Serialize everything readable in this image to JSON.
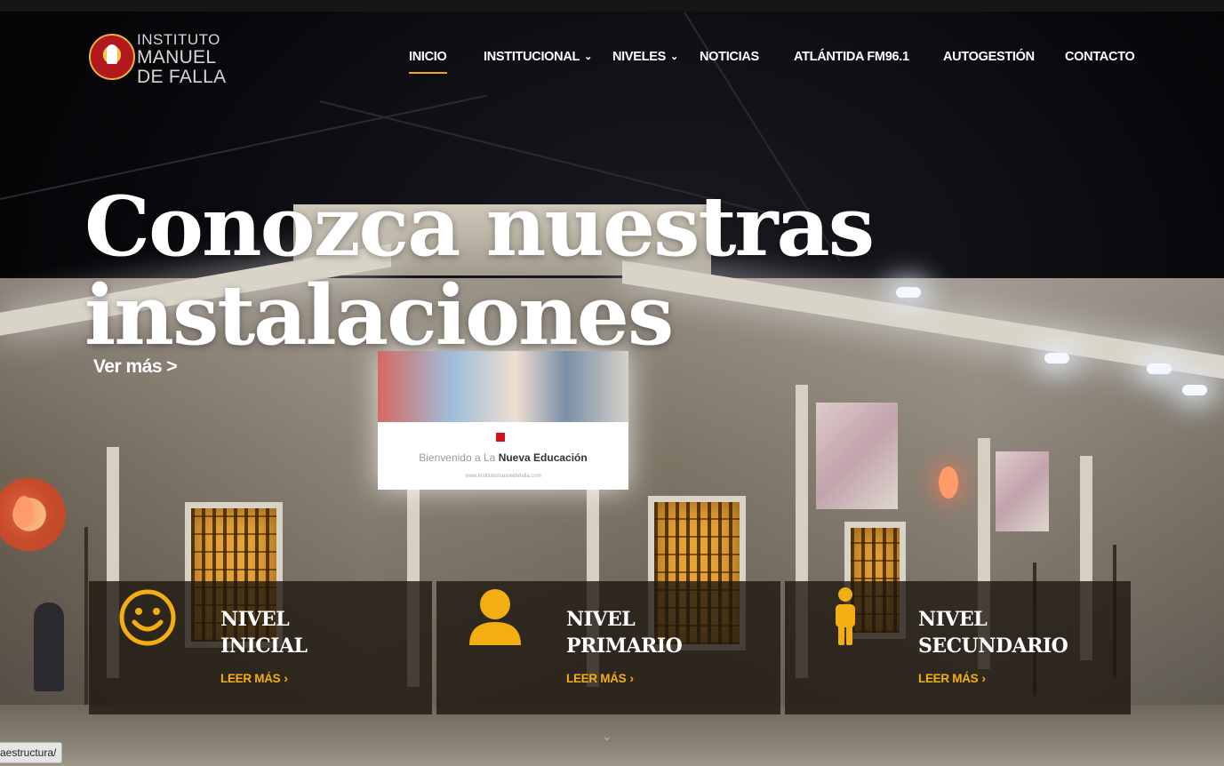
{
  "brand": {
    "line1": "INSTITUTO",
    "line2": "MANUEL",
    "line3": "DE FALLA"
  },
  "nav": {
    "items": [
      {
        "label": "INICIO",
        "active": true,
        "dropdown": false
      },
      {
        "label": "INSTITUCIONAL",
        "active": false,
        "dropdown": true
      },
      {
        "label": "NIVELES",
        "active": false,
        "dropdown": true
      },
      {
        "label": "NOTICIAS",
        "active": false,
        "dropdown": false
      },
      {
        "label": "ATLÁNTIDA FM96.1",
        "active": false,
        "dropdown": false
      },
      {
        "label": "AUTOGESTIÓN",
        "active": false,
        "dropdown": false
      },
      {
        "label": "CONTACTO",
        "active": false,
        "dropdown": false
      }
    ],
    "active_underline_color": "#f1a81f"
  },
  "hero": {
    "headline_line1": "Conozca nuestras",
    "headline_line2": "instalaciones",
    "cta": "Ver más >",
    "billboard": {
      "text_light": "Bienvenido a La",
      "text_bold": "Nueva Educación",
      "url": "www.institutomanueldefalla.com"
    }
  },
  "levels": {
    "accent_color": "#f3ae12",
    "cards": [
      {
        "title_line1": "NIVEL",
        "title_line2": "INICIAL",
        "link": "LEER MÁS",
        "icon": "smiley-icon"
      },
      {
        "title_line1": "NIVEL",
        "title_line2": "PRIMARIO",
        "link": "LEER MÁS",
        "icon": "user-icon"
      },
      {
        "title_line1": "NIVEL",
        "title_line2": "SECUNDARIO",
        "link": "LEER MÁS",
        "icon": "person-standing-icon"
      }
    ]
  },
  "status_bar": {
    "url": "aestructura/"
  }
}
